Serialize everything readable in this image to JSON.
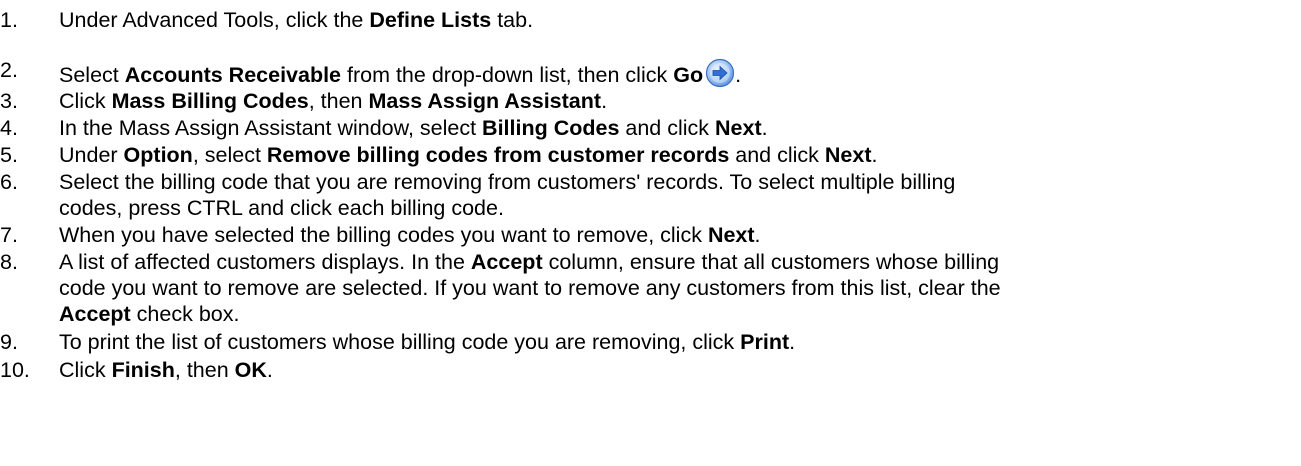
{
  "steps": [
    {
      "num": "1.",
      "a": "Under Advanced Tools, click the ",
      "b": "Define Lists",
      "c": " tab."
    },
    {
      "num": "2.",
      "a": "Select ",
      "b": "Accounts Receivable",
      "c": " from the drop-down list, then click ",
      "d": "Go",
      "e": ".",
      "icon": "go-arrow-icon"
    },
    {
      "num": "3.",
      "a": "Click ",
      "b": "Mass Billing Codes",
      "c": ", then ",
      "d": "Mass Assign Assistant",
      "e": "."
    },
    {
      "num": "4.",
      "a": "In the Mass Assign Assistant window, select ",
      "b": "Billing Codes",
      "c": " and click ",
      "d": "Next",
      "e": "."
    },
    {
      "num": "5.",
      "a": "Under ",
      "b": "Option",
      "c": ", select ",
      "d": "Remove billing codes from customer records",
      "e": " and click ",
      "f": "Next",
      "g": "."
    },
    {
      "num": "6.",
      "line1": "Select the billing code that you are removing from customers' records. To select multiple billing",
      "line2": "codes, press CTRL and click each billing code."
    },
    {
      "num": "7.",
      "a": "When you have selected the billing codes you want to remove, click ",
      "b": "Next",
      "c": "."
    },
    {
      "num": "8.",
      "l1a": "A list of affected customers displays. In the ",
      "l1b": "Accept",
      "l1c": " column, ensure that all customers whose billing",
      "line2": "code you want to remove are selected. If you want to remove any customers from this list, clear the",
      "l3a": "Accept",
      "l3b": " check box."
    },
    {
      "num": "9.",
      "l1": "To print the list of customers whose billing code you are removing, click ",
      "l1b": "Print",
      "l1c": "."
    },
    {
      "num": "10.",
      "a": "Click ",
      "b": "Finish",
      "c": ", then ",
      "d": "OK",
      "e": "."
    }
  ],
  "colors": {
    "text": "#000000",
    "icon_blue": "#2f6fd6",
    "icon_light": "#9cc3f5"
  }
}
